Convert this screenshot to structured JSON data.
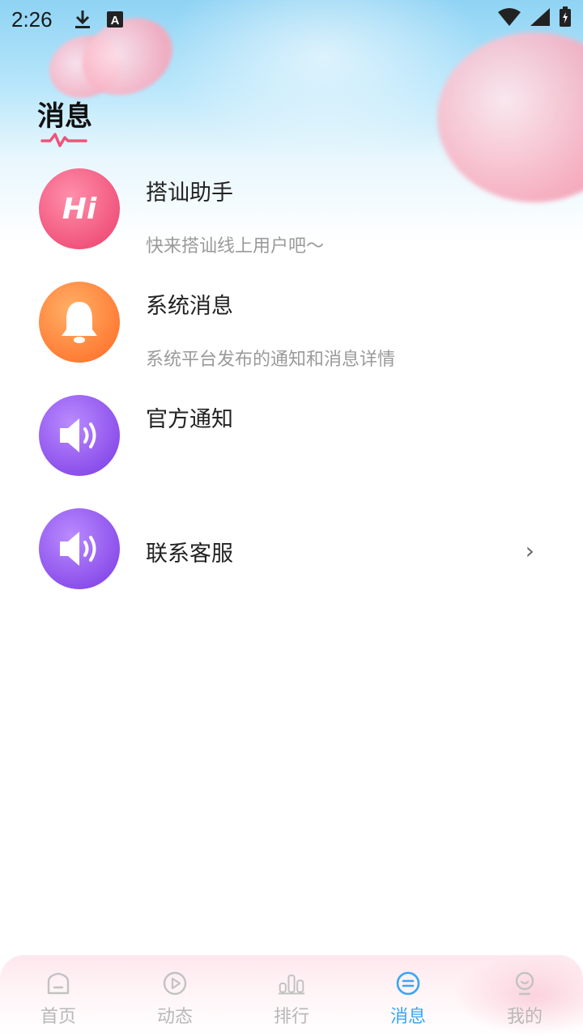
{
  "status_bar": {
    "time": "2:26",
    "icons_left": [
      "download-icon",
      "a-notification-icon"
    ],
    "icons_right": [
      "wifi-icon",
      "signal-icon",
      "battery-icon"
    ]
  },
  "page": {
    "title": "消息"
  },
  "messages": [
    {
      "title": "搭讪助手",
      "subtitle": "快来搭讪线上用户吧～",
      "icon": "hi-icon",
      "avatar_text": "Hi",
      "color": "#f0527a"
    },
    {
      "title": "系统消息",
      "subtitle": "系统平台发布的通知和消息详情",
      "icon": "bell-icon",
      "color": "#ff7a33"
    },
    {
      "title": "官方通知",
      "subtitle": "",
      "icon": "speaker-icon",
      "color": "#8a4dea"
    },
    {
      "title": "联系客服",
      "subtitle": "",
      "icon": "speaker-icon",
      "color": "#8a4dea",
      "chevron": "›"
    }
  ],
  "bottom_nav": {
    "active_index": 3,
    "active_color": "#39a5f3",
    "items": [
      {
        "label": "首页",
        "icon": "home-icon"
      },
      {
        "label": "动态",
        "icon": "play-icon"
      },
      {
        "label": "排行",
        "icon": "ranking-icon"
      },
      {
        "label": "消息",
        "icon": "message-icon"
      },
      {
        "label": "我的",
        "icon": "profile-icon"
      }
    ]
  }
}
